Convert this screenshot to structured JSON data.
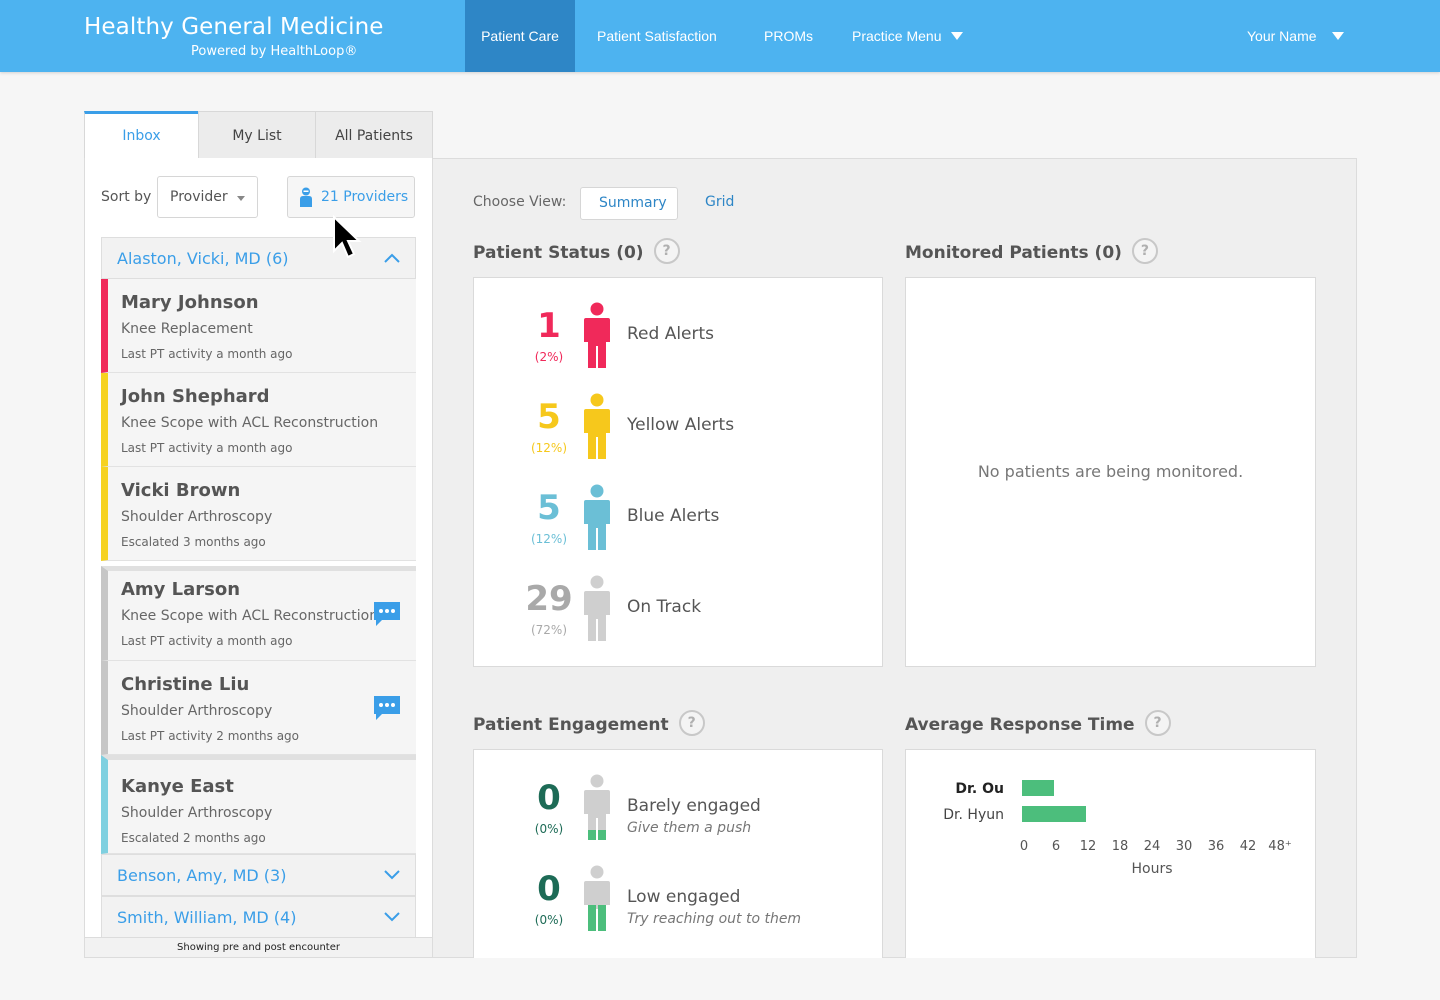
{
  "brand": {
    "title": "Healthy General Medicine",
    "subtitle": "Powered by HealthLoop®"
  },
  "nav": {
    "patient_care": "Patient Care",
    "patient_satisfaction": "Patient Satisfaction",
    "proms": "PROMs",
    "practice_menu": "Practice Menu",
    "user": "Your Name"
  },
  "tabs": {
    "inbox": "Inbox",
    "my_list": "My List",
    "all_patients": "All Patients"
  },
  "sort": {
    "label": "Sort by",
    "value": "Provider",
    "providers_button": "21 Providers"
  },
  "groups": [
    {
      "label": "Alaston, Vicki, MD (6)",
      "expanded": true
    },
    {
      "label": "Benson, Amy, MD (3)",
      "expanded": false
    },
    {
      "label": "Smith, William, MD (4)",
      "expanded": false
    }
  ],
  "patients": [
    {
      "name": "Mary Johnson",
      "procedure": "Knee Replacement",
      "activity": "Last PT activity a month ago",
      "status_color": "#f0295a",
      "has_message": false
    },
    {
      "name": "John Shephard",
      "procedure": "Knee Scope with ACL Reconstruction",
      "activity": "Last PT activity a month ago",
      "status_color": "#f6d21f",
      "has_message": false
    },
    {
      "name": "Vicki Brown",
      "procedure": "Shoulder Arthroscopy",
      "activity": "Escalated 3 months ago",
      "status_color": "#f6d21f",
      "has_message": false
    },
    {
      "name": "Amy Larson",
      "procedure": "Knee Scope with ACL Reconstruction",
      "activity": "Last PT activity a month ago",
      "status_color": "#c6c6c6",
      "has_message": true
    },
    {
      "name": "Christine Liu",
      "procedure": "Shoulder Arthroscopy",
      "activity": "Last PT activity 2 months ago",
      "status_color": "#c6c6c6",
      "has_message": true
    },
    {
      "name": "Kanye East",
      "procedure": "Shoulder Arthroscopy",
      "activity": "Escalated 2 months ago",
      "status_color": "#7fd0e0",
      "has_message": false
    }
  ],
  "footer_note": "Showing pre and post encounter",
  "view": {
    "label": "Choose View:",
    "summary": "Summary",
    "grid": "Grid"
  },
  "patient_status": {
    "title": "Patient Status (0)",
    "help": "?",
    "rows": [
      {
        "count": "1",
        "percent": "(2%)",
        "label": "Red Alerts",
        "color": "#f0295a"
      },
      {
        "count": "5",
        "percent": "(12%)",
        "label": "Yellow Alerts",
        "color": "#f6c81c"
      },
      {
        "count": "5",
        "percent": "(12%)",
        "label": "Blue Alerts",
        "color": "#6bbfd6"
      },
      {
        "count": "29",
        "percent": "(72%)",
        "label": "On Track",
        "color": "#a9a9a9"
      }
    ]
  },
  "monitored": {
    "title": "Monitored Patients (0)",
    "help": "?",
    "empty": "No patients are being monitored."
  },
  "engagement": {
    "title": "Patient Engagement",
    "help": "?",
    "rows": [
      {
        "count": "0",
        "percent": "(0%)",
        "label": "Barely engaged",
        "sub": "Give them a push",
        "color": "#1d6b56",
        "fill_level": 0.15
      },
      {
        "count": "0",
        "percent": "(0%)",
        "label": "Low engaged",
        "sub": "Try reaching out to them",
        "color": "#1d6b56",
        "fill_level": 0.45
      }
    ]
  },
  "response_time": {
    "title": "Average Response Time",
    "help": "?"
  },
  "chart_data": {
    "type": "bar",
    "orientation": "horizontal",
    "categories": [
      "Dr. Ou",
      "Dr. Hyun"
    ],
    "values": [
      6,
      12
    ],
    "xlabel": "Hours",
    "xticks": [
      "0",
      "6",
      "12",
      "18",
      "24",
      "30",
      "36",
      "42",
      "48⁺"
    ],
    "xlim": [
      0,
      48
    ],
    "bar_color": "#4cbe7c"
  }
}
